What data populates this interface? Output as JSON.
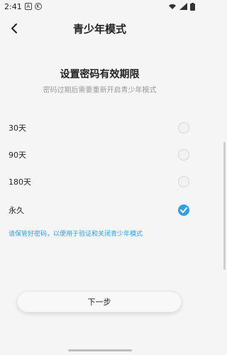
{
  "status_bar": {
    "time": "2:41",
    "icons": [
      "wifi-icon",
      "signal-icon",
      "battery-icon"
    ]
  },
  "top_bar": {
    "title": "青少年模式",
    "back_icon": "back-chevron-icon"
  },
  "content": {
    "heading": "设置密码有效期限",
    "subheading": "密码过期后需要重新开启青少年模式",
    "options": [
      {
        "label": "30天",
        "selected": false
      },
      {
        "label": "90天",
        "selected": false
      },
      {
        "label": "180天",
        "selected": false
      },
      {
        "label": "永久",
        "selected": true
      }
    ],
    "notice": "请保管好密码，以便用于验证和关闭青少年模式"
  },
  "actions": {
    "next_label": "下一步"
  },
  "colors": {
    "accent": "#2ea0e6",
    "background": "#f5f5f5"
  }
}
